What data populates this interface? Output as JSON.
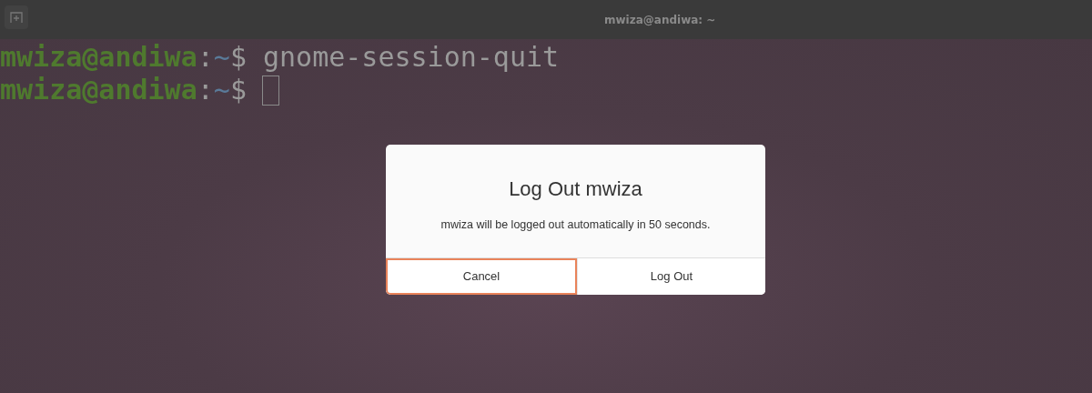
{
  "window": {
    "title": "mwiza@andiwa: ~"
  },
  "terminal": {
    "lines": [
      {
        "user_host": "mwiza@andiwa",
        "separator": ":",
        "path": "~",
        "prompt": "$",
        "command": "gnome-session-quit",
        "cursor": false
      },
      {
        "user_host": "mwiza@andiwa",
        "separator": ":",
        "path": "~",
        "prompt": "$",
        "cursor": true
      }
    ]
  },
  "dialog": {
    "title": "Log Out mwiza",
    "message": "mwiza will be logged out automatically in 50 seconds.",
    "buttons": [
      {
        "label": "Cancel",
        "selected": true
      },
      {
        "label": "Log Out",
        "selected": false
      }
    ]
  }
}
